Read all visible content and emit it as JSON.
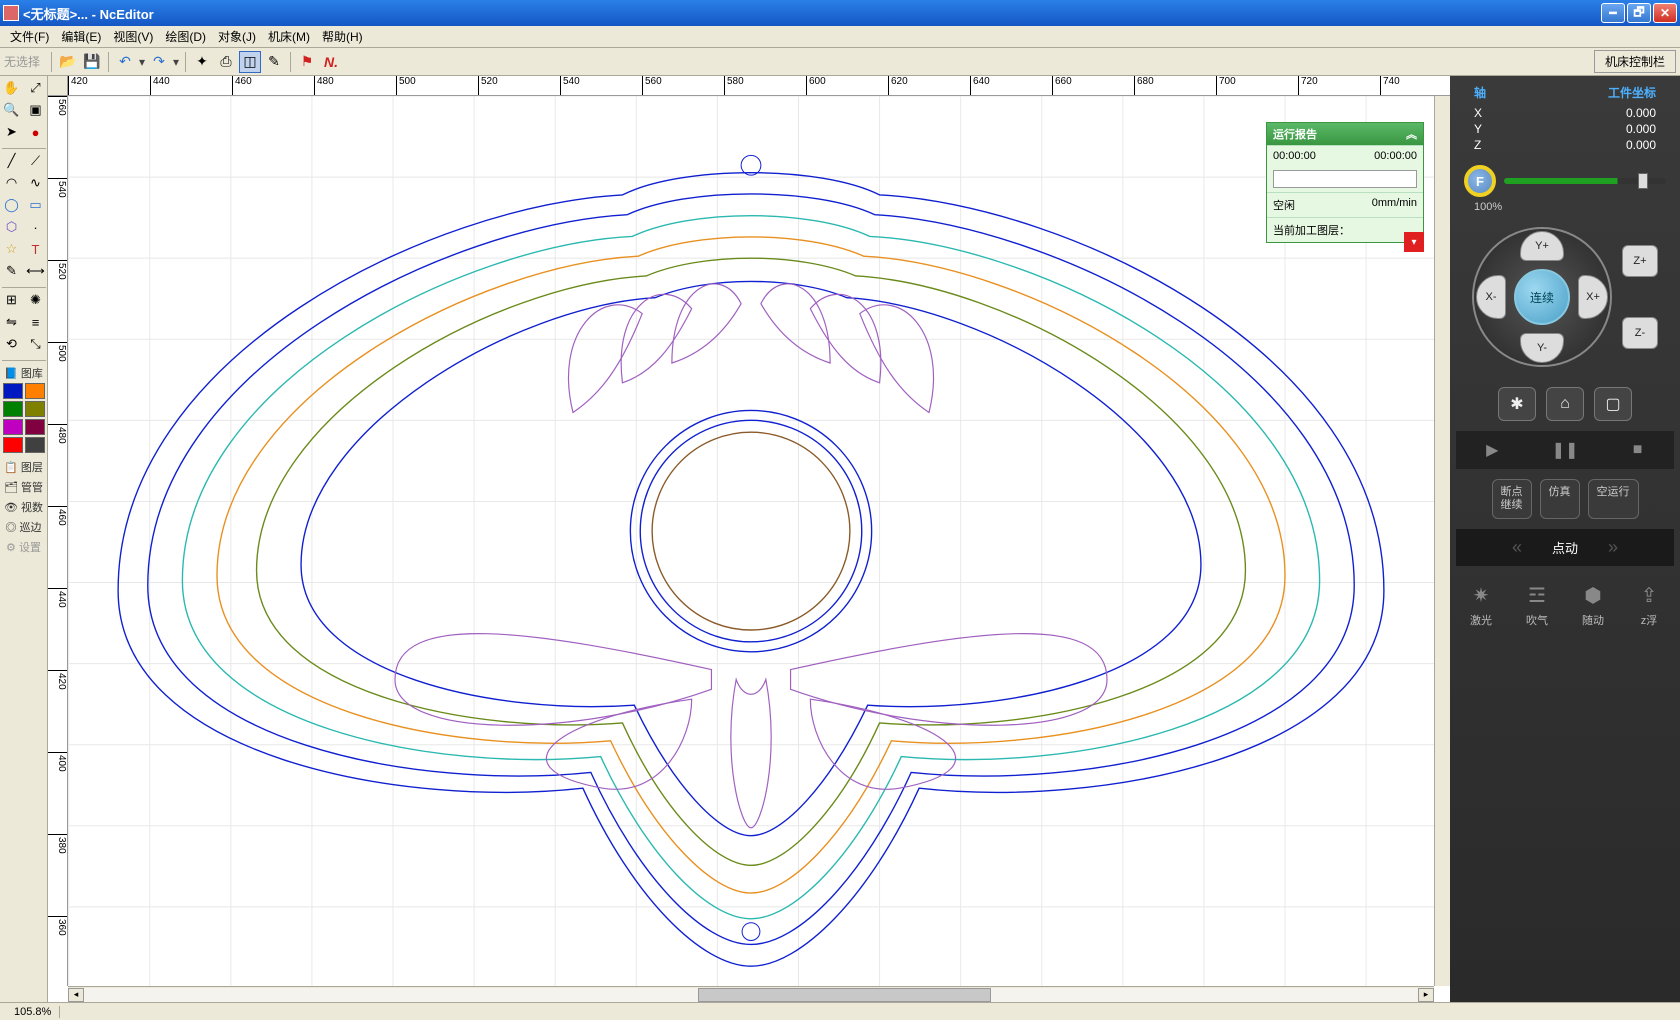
{
  "title": "<无标题>... - NcEditor",
  "menu": [
    "文件(F)",
    "编辑(E)",
    "视图(V)",
    "绘图(D)",
    "对象(J)",
    "机床(M)",
    "帮助(H)"
  ],
  "toolbar": {
    "selection_label": "无选择",
    "right_button": "机床控制栏"
  },
  "ruler_h": [
    420,
    440,
    460,
    480,
    500,
    520,
    540,
    560,
    580,
    600,
    620,
    640,
    660,
    680,
    700,
    720,
    740
  ],
  "ruler_v": [
    560,
    540,
    520,
    500,
    480,
    460,
    440,
    420,
    400,
    380,
    360
  ],
  "left": {
    "sections": {
      "lib": "图库",
      "layer": "图层",
      "mgr": "管管",
      "view": "视数",
      "edge": "巡边",
      "settings": "设置"
    },
    "colors": [
      "#0018c0",
      "#ff8000",
      "#008000",
      "#808000",
      "#c000c0",
      "#800040",
      "#ff0000",
      "#404040"
    ]
  },
  "report": {
    "title": "运行报告",
    "t1": "00:00:00",
    "t2": "00:00:00",
    "idle": "空闲",
    "speed": "0mm/min",
    "layer_label": "当前加工图层："
  },
  "panel": {
    "axis_header": "轴",
    "coord_header": "工件坐标",
    "axes": [
      {
        "name": "X",
        "val": "0.000"
      },
      {
        "name": "Y",
        "val": "0.000"
      },
      {
        "name": "Z",
        "val": "0.000"
      }
    ],
    "feed_letter": "F",
    "feed_pct": "100%",
    "jog": {
      "yp": "Y+",
      "ym": "Y-",
      "xp": "X+",
      "xm": "X-",
      "zp": "Z+",
      "zm": "Z-",
      "center": "连续"
    },
    "modes": [
      "断点\n继续",
      "仿真",
      "空运行"
    ],
    "nav_label": "点动",
    "fns": [
      {
        "icon": "✷",
        "label": "激光"
      },
      {
        "icon": "☲",
        "label": "吹气"
      },
      {
        "icon": "⬢",
        "label": "随动"
      },
      {
        "icon": "⇪",
        "label": "z浮"
      }
    ]
  },
  "status": {
    "zoom": "105.8%"
  }
}
